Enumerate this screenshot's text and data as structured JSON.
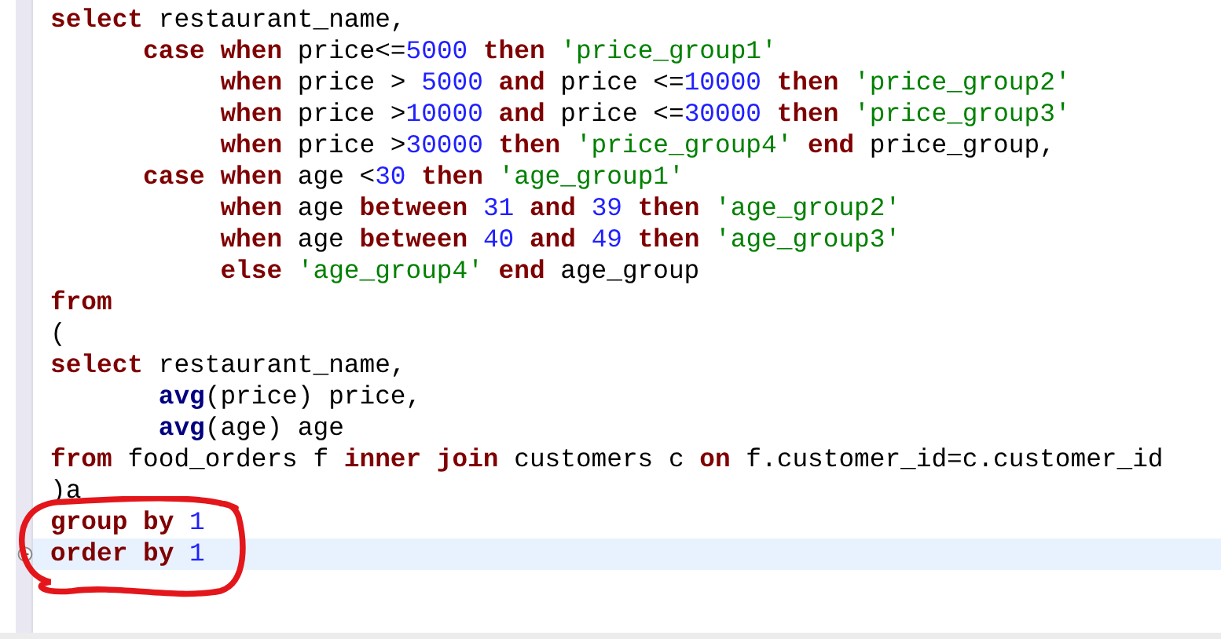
{
  "editor": {
    "lines": [
      {
        "current": false,
        "fold": false,
        "tokens": [
          {
            "kind": "kw",
            "text": "select"
          },
          {
            "kind": "plain",
            "text": " restaurant_name,"
          }
        ]
      },
      {
        "current": false,
        "fold": false,
        "tokens": [
          {
            "kind": "kw",
            "text": "      case "
          },
          {
            "kind": "kw",
            "text": "when"
          },
          {
            "kind": "plain",
            "text": " price<="
          },
          {
            "kind": "num",
            "text": "5000 "
          },
          {
            "kind": "kw",
            "text": "then "
          },
          {
            "kind": "str",
            "text": "'price_group1'"
          }
        ]
      },
      {
        "current": false,
        "fold": false,
        "tokens": [
          {
            "kind": "kw",
            "text": "           when"
          },
          {
            "kind": "plain",
            "text": " price > "
          },
          {
            "kind": "num",
            "text": "5000 "
          },
          {
            "kind": "kw",
            "text": "and"
          },
          {
            "kind": "plain",
            "text": " price <="
          },
          {
            "kind": "num",
            "text": "10000 "
          },
          {
            "kind": "kw",
            "text": "then "
          },
          {
            "kind": "str",
            "text": "'price_group2'"
          }
        ]
      },
      {
        "current": false,
        "fold": false,
        "tokens": [
          {
            "kind": "kw",
            "text": "           when"
          },
          {
            "kind": "plain",
            "text": " price >"
          },
          {
            "kind": "num",
            "text": "10000 "
          },
          {
            "kind": "kw",
            "text": "and"
          },
          {
            "kind": "plain",
            "text": " price <="
          },
          {
            "kind": "num",
            "text": "30000 "
          },
          {
            "kind": "kw",
            "text": "then "
          },
          {
            "kind": "str",
            "text": "'price_group3'"
          }
        ]
      },
      {
        "current": false,
        "fold": false,
        "tokens": [
          {
            "kind": "kw",
            "text": "           when"
          },
          {
            "kind": "plain",
            "text": " price >"
          },
          {
            "kind": "num",
            "text": "30000 "
          },
          {
            "kind": "kw",
            "text": "then "
          },
          {
            "kind": "str",
            "text": "'price_group4' "
          },
          {
            "kind": "kw",
            "text": "end"
          },
          {
            "kind": "plain",
            "text": " price_group,"
          }
        ]
      },
      {
        "current": false,
        "fold": false,
        "tokens": [
          {
            "kind": "kw",
            "text": "      case "
          },
          {
            "kind": "kw",
            "text": "when"
          },
          {
            "kind": "plain",
            "text": " age <"
          },
          {
            "kind": "num",
            "text": "30 "
          },
          {
            "kind": "kw",
            "text": "then "
          },
          {
            "kind": "str",
            "text": "'age_group1'"
          }
        ]
      },
      {
        "current": false,
        "fold": false,
        "tokens": [
          {
            "kind": "kw",
            "text": "           when"
          },
          {
            "kind": "plain",
            "text": " age "
          },
          {
            "kind": "kw",
            "text": "between "
          },
          {
            "kind": "num",
            "text": "31 "
          },
          {
            "kind": "kw",
            "text": "and "
          },
          {
            "kind": "num",
            "text": "39 "
          },
          {
            "kind": "kw",
            "text": "then "
          },
          {
            "kind": "str",
            "text": "'age_group2'"
          }
        ]
      },
      {
        "current": false,
        "fold": false,
        "tokens": [
          {
            "kind": "kw",
            "text": "           when"
          },
          {
            "kind": "plain",
            "text": " age "
          },
          {
            "kind": "kw",
            "text": "between "
          },
          {
            "kind": "num",
            "text": "40 "
          },
          {
            "kind": "kw",
            "text": "and "
          },
          {
            "kind": "num",
            "text": "49 "
          },
          {
            "kind": "kw",
            "text": "then "
          },
          {
            "kind": "str",
            "text": "'age_group3'"
          }
        ]
      },
      {
        "current": false,
        "fold": false,
        "tokens": [
          {
            "kind": "kw",
            "text": "           else "
          },
          {
            "kind": "str",
            "text": "'age_group4' "
          },
          {
            "kind": "kw",
            "text": "end"
          },
          {
            "kind": "plain",
            "text": " age_group"
          }
        ]
      },
      {
        "current": false,
        "fold": false,
        "tokens": [
          {
            "kind": "kw",
            "text": "from"
          }
        ]
      },
      {
        "current": false,
        "fold": false,
        "tokens": [
          {
            "kind": "plain",
            "text": "("
          }
        ]
      },
      {
        "current": false,
        "fold": false,
        "tokens": [
          {
            "kind": "kw",
            "text": "select"
          },
          {
            "kind": "plain",
            "text": " restaurant_name,"
          }
        ]
      },
      {
        "current": false,
        "fold": false,
        "tokens": [
          {
            "kind": "fn",
            "text": "       avg"
          },
          {
            "kind": "plain",
            "text": "(price) price,"
          }
        ]
      },
      {
        "current": false,
        "fold": false,
        "tokens": [
          {
            "kind": "fn",
            "text": "       avg"
          },
          {
            "kind": "plain",
            "text": "(age) age"
          }
        ]
      },
      {
        "current": false,
        "fold": false,
        "tokens": [
          {
            "kind": "kw",
            "text": "from"
          },
          {
            "kind": "plain",
            "text": " food_orders f "
          },
          {
            "kind": "kw",
            "text": "inner join"
          },
          {
            "kind": "plain",
            "text": " customers c "
          },
          {
            "kind": "kw",
            "text": "on"
          },
          {
            "kind": "plain",
            "text": " f.customer_id=c.customer_id"
          }
        ]
      },
      {
        "current": false,
        "fold": false,
        "tokens": [
          {
            "kind": "plain",
            "text": ")a"
          }
        ]
      },
      {
        "current": false,
        "fold": false,
        "tokens": [
          {
            "kind": "kw",
            "text": "group by "
          },
          {
            "kind": "num",
            "text": "1"
          }
        ]
      },
      {
        "current": true,
        "fold": true,
        "tokens": [
          {
            "kind": "kw",
            "text": "order by "
          },
          {
            "kind": "num",
            "text": "1"
          }
        ]
      }
    ]
  }
}
